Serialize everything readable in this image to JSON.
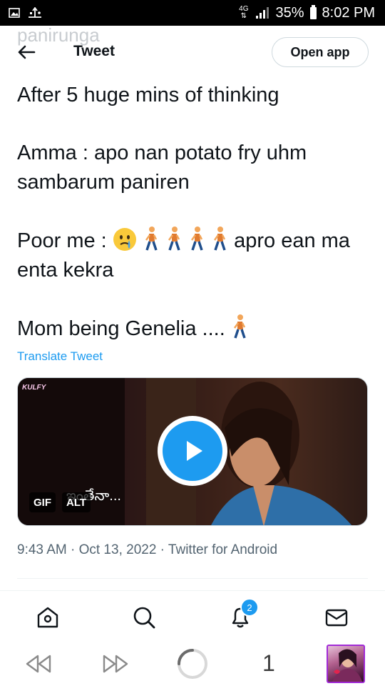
{
  "status_bar": {
    "network": "4G",
    "battery": "35%",
    "time": "8:02 PM"
  },
  "header": {
    "ghost_username": "panirunga",
    "title": "Tweet",
    "open_app_label": "Open app"
  },
  "tweet": {
    "lines": [
      "After 5 huge mins of thinking",
      "Amma : apo nan potato fry uhm sambarum paniren",
      "Poor me :",
      "apro ean ma enta kekra",
      "Mom being  Genelia ...."
    ],
    "translate_label": "Translate Tweet",
    "media": {
      "watermark": "KULFY",
      "subtitle": "ఇంతేనా...",
      "gif_badge": "GIF",
      "alt_badge": "ALT"
    },
    "meta": "9:43 AM · Oct 13, 2022 · Twitter for Android"
  },
  "bottom_nav": {
    "notifications_count": "2"
  },
  "browser_bar": {
    "tab_count": "1"
  },
  "colors": {
    "accent": "#1d9bf0",
    "text": "#0f1419",
    "secondary_text": "#536471"
  }
}
